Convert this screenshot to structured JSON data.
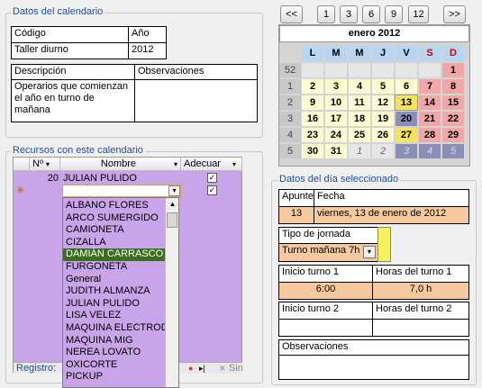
{
  "calendar_data": {
    "title": "Datos del calendario",
    "codigo_label": "Código",
    "ano_label": "Año",
    "codigo_value": "Taller diurno",
    "ano_value": "2012",
    "descripcion_label": "Descripción",
    "observaciones_label": "Observaciones",
    "descripcion_value": "Operarios que comienzan el año en turno de mañana",
    "observaciones_value": ""
  },
  "nav_buttons": [
    "<<",
    "1",
    "3",
    "6",
    "9",
    "12",
    ">>"
  ],
  "calendar": {
    "month_title": "enero 2012",
    "dow": [
      "L",
      "M",
      "M",
      "J",
      "V",
      "S",
      "D"
    ],
    "weeks": [
      {
        "num": "52",
        "days": [
          "",
          "",
          "",
          "",
          "",
          "",
          "1"
        ]
      },
      {
        "num": "1",
        "days": [
          "2",
          "3",
          "4",
          "5",
          "6",
          "7",
          "8"
        ]
      },
      {
        "num": "2",
        "days": [
          "9",
          "10",
          "11",
          "12",
          "13",
          "14",
          "15"
        ]
      },
      {
        "num": "3",
        "days": [
          "16",
          "17",
          "18",
          "19",
          "20",
          "21",
          "22"
        ]
      },
      {
        "num": "4",
        "days": [
          "23",
          "24",
          "25",
          "26",
          "27",
          "28",
          "29"
        ]
      },
      {
        "num": "5",
        "days": [
          "30",
          "31",
          "1",
          "2",
          "3",
          "4",
          "5"
        ]
      }
    ]
  },
  "resources": {
    "title": "Recursos con este calendario",
    "col_num": "Nº",
    "col_nombre": "Nombre",
    "col_adecuar": "Adecuar",
    "rows": [
      {
        "num": "20",
        "nombre": "JULIAN PULIDO",
        "adecuar": true
      }
    ],
    "new_row_marker": "✳",
    "dropdown_items": [
      "ALBANO FLORES",
      "ARCO SUMERGIDO",
      "CAMIONETA",
      "CIZALLA",
      "DAMIÁN CARRASCO",
      "FURGONETA",
      "General",
      "JUDITH ALMANZA",
      "JULIAN PULIDO",
      "LISA VELEZ",
      "MAQUINA ELECTRODO",
      "MAQUINA MIG",
      "NEREA LOVATO",
      "OXICORTE",
      "PICKUP"
    ],
    "selected_item": "DAMIÁN CARRASCO",
    "record_label": "Registro:",
    "nofilter_label": "Sin"
  },
  "day_data": {
    "title": "Datos del día seleccionado",
    "apunte_label": "Apunte",
    "fecha_label": "Fecha",
    "apunte_value": "13",
    "fecha_value": "viernes, 13 de enero de 2012",
    "tipo_label": "Tipo de jornada",
    "tipo_value": "Turno mañana 7h",
    "inicio1_label": "Inicio turno 1",
    "horas1_label": "Horas del turno 1",
    "inicio1_value": "6:00",
    "horas1_value": "7,0 h",
    "inicio2_label": "Inicio turno 2",
    "horas2_label": "Horas del turno 2",
    "inicio2_value": "",
    "horas2_value": "",
    "obs_label": "Observaciones",
    "obs_value": ""
  },
  "colors": {
    "weekday_bg": "#fffbd0",
    "weekend_bg": "#f2a6a6",
    "other_month_bg": "#e6e6e6",
    "today_bg": "#f6e35a",
    "selected_bg": "#8a8fb8",
    "sunday_color": "#d40000",
    "list_bg": "#c8a4e8",
    "highlight_bg": "#f6c89e"
  }
}
